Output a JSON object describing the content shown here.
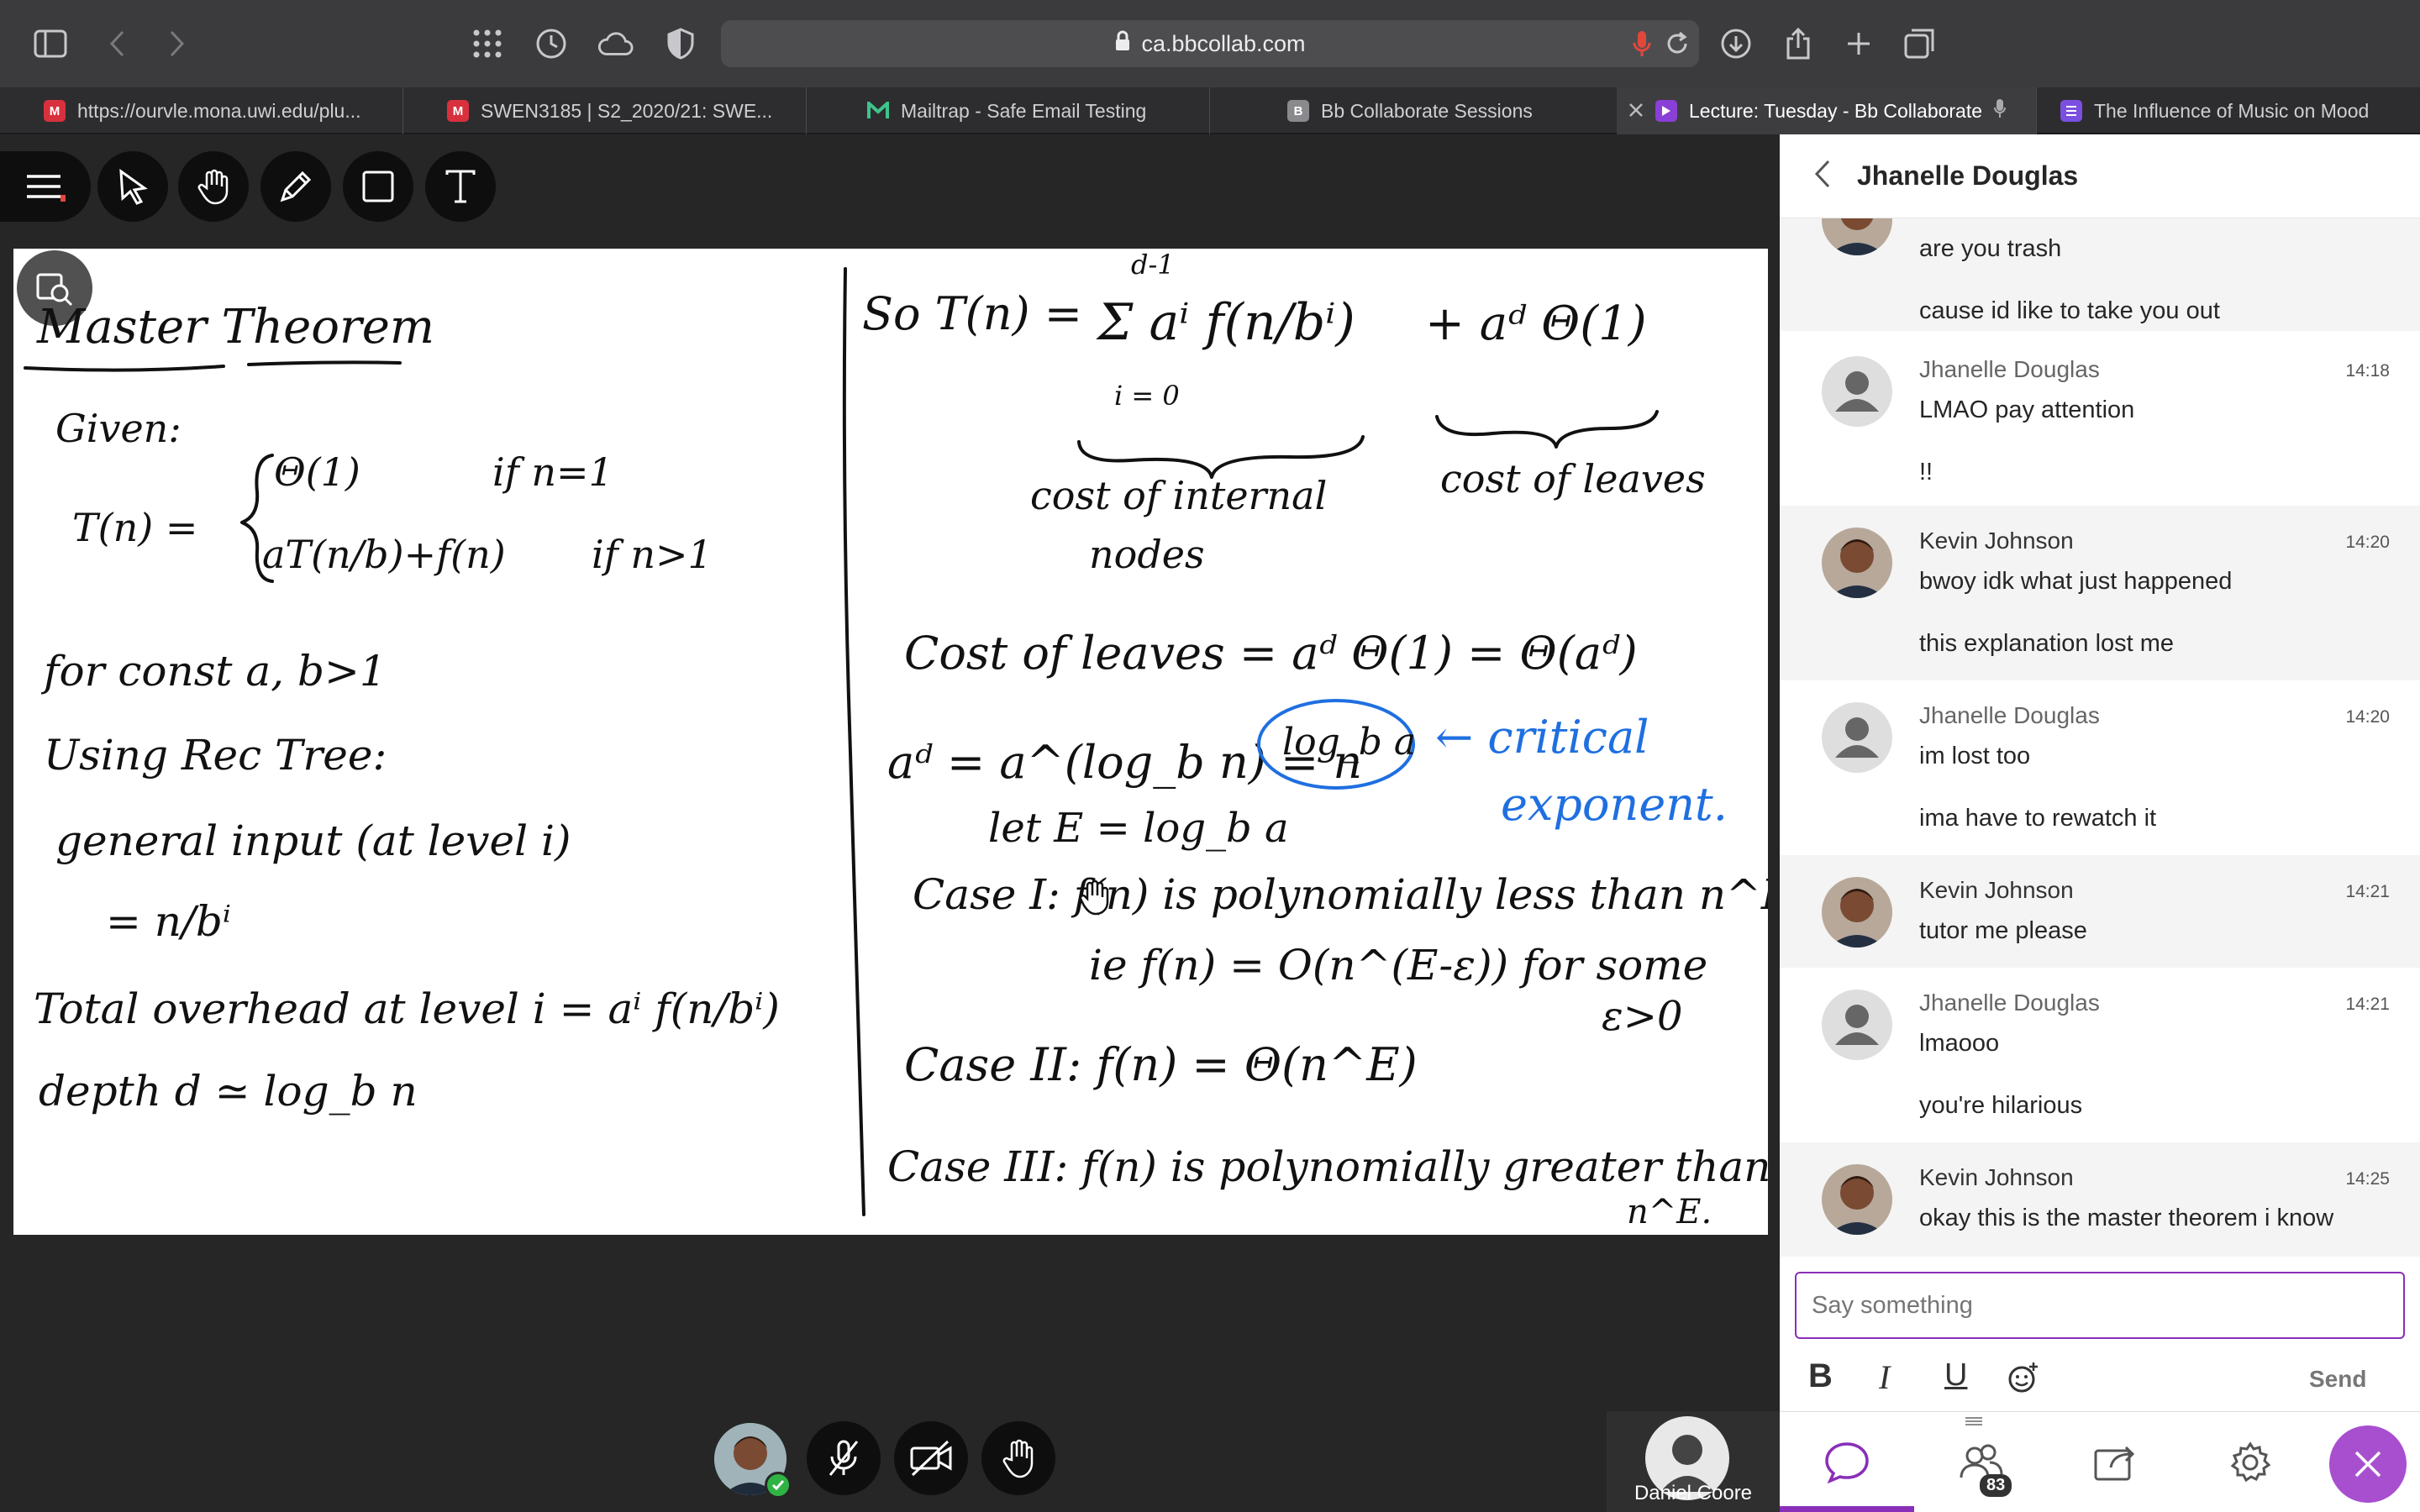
{
  "browser": {
    "url": "ca.bbcollab.com",
    "tabs": [
      {
        "label": "https://ourvle.mona.uwi.edu/plu...",
        "favicon": "m-red-icon",
        "active": false
      },
      {
        "label": "SWEN3185 | S2_2020/21: SWE...",
        "favicon": "m-red-icon",
        "active": false
      },
      {
        "label": "Mailtrap - Safe Email Testing",
        "favicon": "mailtrap-icon",
        "active": false
      },
      {
        "label": "Bb Collaborate Sessions",
        "favicon": "bb-gray-icon",
        "active": false
      },
      {
        "label": "Lecture: Tuesday - Bb Collaborate",
        "favicon": "bb-purple-icon",
        "active": true
      },
      {
        "label": "The Influence of Music on Mood",
        "favicon": "list-purple-icon",
        "active": false
      }
    ]
  },
  "whiteboard": {
    "left": {
      "title": "Master Theorem",
      "given": "Given:",
      "case_top": "Θ(1)",
      "case_top_cond": "if n=1",
      "tn": "T(n) =",
      "case_bottom": "aT(n/b)+f(n)",
      "case_bottom_cond": "if n>1",
      "const": "for const a, b>1",
      "using": "Using Rec Tree:",
      "general": "general input (at level i)",
      "equals": "= n/bⁱ",
      "total": "Total overhead at level i = aⁱ f(n/bⁱ)",
      "depth": "depth d ≃ log_b n"
    },
    "right": {
      "so": "So T(n) =",
      "sum_top": "d-1",
      "sum": "Σ aⁱ f(n/bⁱ)",
      "sum_bottom": "i = 0",
      "plus": "+ aᵈ Θ(1)",
      "internal": "cost of internal",
      "nodes": "nodes",
      "leaves": "cost of leaves",
      "cost_leaves": "Cost of leaves = aᵈ Θ(1) = Θ(aᵈ)",
      "ad": "aᵈ = a^(log_b n) = n",
      "logba": "log_b a",
      "critical": "← critical",
      "exponent": "exponent.",
      "let": "let E = log_b a",
      "case1": "Case I: f(n) is polynomially less than n^E",
      "case1b": "ie f(n) = O(n^(E-ε)) for some",
      "eps": "ε>0",
      "case2": "Case II: f(n) = Θ(n^E)",
      "case3": "Case III: f(n) is polynomially greater than",
      "case3b": "n^E."
    }
  },
  "chat": {
    "contact": "Jhanelle Douglas",
    "messages": [
      {
        "name": "",
        "time": "",
        "lines": [
          "are you trash",
          "cause id like to take you out"
        ],
        "avatar": "photo"
      },
      {
        "name": "Jhanelle Douglas",
        "time": "14:18",
        "lines": [
          "LMAO pay attention",
          "!!"
        ],
        "avatar": "generic"
      },
      {
        "name": "Kevin Johnson",
        "time": "14:20",
        "lines": [
          "bwoy idk what just happened",
          "this explanation lost me"
        ],
        "avatar": "photo"
      },
      {
        "name": "Jhanelle Douglas",
        "time": "14:20",
        "lines": [
          "im lost too",
          "ima have to rewatch it"
        ],
        "avatar": "generic"
      },
      {
        "name": "Kevin Johnson",
        "time": "14:21",
        "lines": [
          "tutor me please"
        ],
        "avatar": "photo"
      },
      {
        "name": "Jhanelle Douglas",
        "time": "14:21",
        "lines": [
          "lmaooo",
          "you're hilarious"
        ],
        "avatar": "generic"
      },
      {
        "name": "Kevin Johnson",
        "time": "14:25",
        "lines": [
          "okay this is the master theorem i know"
        ],
        "avatar": "photo"
      }
    ],
    "placeholder": "Say something",
    "format": {
      "bold": "B",
      "italic": "I",
      "underline": "U"
    },
    "send": "Send",
    "participants_count": "83"
  },
  "presenter": {
    "name": "Daniel Coore"
  },
  "colors": {
    "accent": "#8a2fb8",
    "ink": "#111111",
    "blue_ink": "#1f6fe0",
    "stage": "#262626",
    "online": "#2fb344"
  }
}
